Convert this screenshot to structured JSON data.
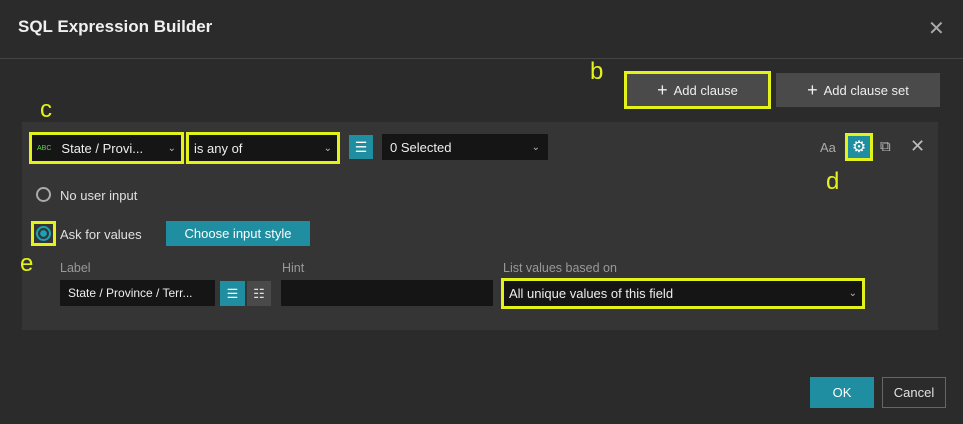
{
  "dialog": {
    "title": "SQL Expression Builder",
    "close_icon": "close-icon"
  },
  "toolbar": {
    "add_clause": "Add clause",
    "add_clause_set": "Add clause set"
  },
  "clause": {
    "field_badge": "ABC",
    "field": "State / Provi...",
    "operator": "is any of",
    "value": "0 Selected",
    "case_label": "Aa"
  },
  "input_options": {
    "no_user_input": "No user input",
    "ask_for_values": "Ask for values",
    "choose_input_style": "Choose input style",
    "selected": "ask_for_values"
  },
  "ask": {
    "label_title": "Label",
    "label_value": "State / Province / Terr...",
    "hint_title": "Hint",
    "hint_value": "",
    "list_title": "List values based on",
    "list_value": "All unique values of this field"
  },
  "footer": {
    "ok": "OK",
    "cancel": "Cancel"
  },
  "annotations": {
    "b": "b",
    "c": "c",
    "d": "d",
    "e": "e"
  },
  "colors": {
    "accent": "#1e8ea0",
    "highlight": "#e3f21a"
  }
}
